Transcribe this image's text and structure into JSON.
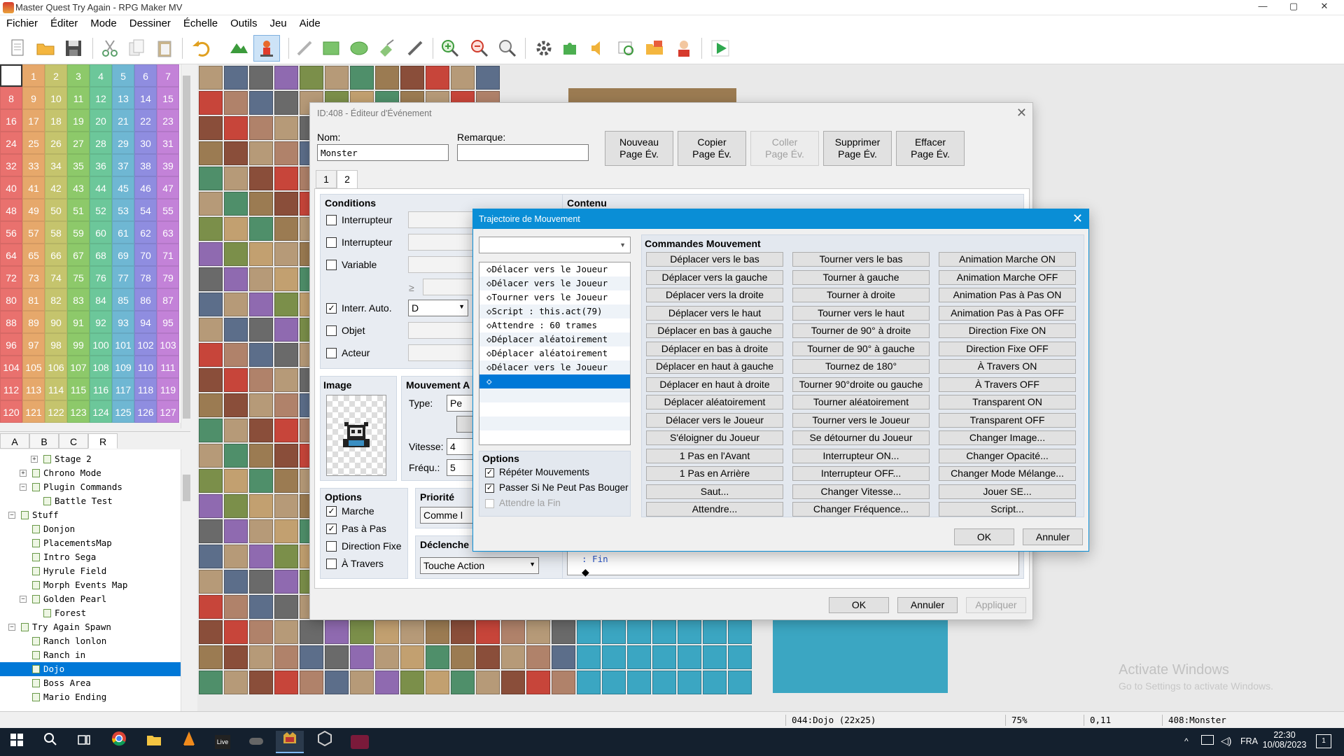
{
  "titlebar": {
    "title": "Master Quest Try Again - RPG Maker MV",
    "min": "—",
    "max": "▢",
    "close": "✕"
  },
  "menu": [
    "Fichier",
    "Éditer",
    "Mode",
    "Dessiner",
    "Échelle",
    "Outils",
    "Jeu",
    "Aide"
  ],
  "numgrid": {
    "cells": [
      "",
      "1",
      "2",
      "3",
      "4",
      "5",
      "6",
      "7",
      "8",
      "9",
      "10",
      "11",
      "12",
      "13",
      "14",
      "15",
      "16",
      "17",
      "18",
      "19",
      "20",
      "21",
      "22",
      "23",
      "24",
      "25",
      "26",
      "27",
      "28",
      "29",
      "30",
      "31",
      "32",
      "33",
      "34",
      "35",
      "36",
      "37",
      "38",
      "39",
      "40",
      "41",
      "42",
      "43",
      "44",
      "45",
      "46",
      "47",
      "48",
      "49",
      "50",
      "51",
      "52",
      "53",
      "54",
      "55",
      "56",
      "57",
      "58",
      "59",
      "60",
      "61",
      "62",
      "63",
      "64",
      "65",
      "66",
      "67",
      "68",
      "69",
      "70",
      "71",
      "72",
      "73",
      "74",
      "75",
      "76",
      "77",
      "78",
      "79",
      "80",
      "81",
      "82",
      "83",
      "84",
      "85",
      "86",
      "87",
      "88",
      "89",
      "90",
      "91",
      "92",
      "93",
      "94",
      "95",
      "96",
      "97",
      "98",
      "99",
      "100",
      "101",
      "102",
      "103",
      "104",
      "105",
      "106",
      "107",
      "108",
      "109",
      "110",
      "111",
      "112",
      "113",
      "114",
      "115",
      "116",
      "117",
      "118",
      "119",
      "120",
      "121",
      "122",
      "123",
      "124",
      "125",
      "126",
      "127"
    ],
    "colors": [
      "#e9716e",
      "#e6a86b",
      "#c5c46d",
      "#8dc96a",
      "#6cc79a",
      "#6fb7d3",
      "#8f8de0",
      "#c382d8"
    ]
  },
  "layer_tabs": [
    "A",
    "B",
    "C",
    "R"
  ],
  "tree": [
    {
      "label": "Stage 2",
      "depth": 2,
      "exp": "+"
    },
    {
      "label": "Chrono Mode",
      "depth": 1,
      "exp": "+"
    },
    {
      "label": "Plugin Commands",
      "depth": 1,
      "exp": "−"
    },
    {
      "label": "Battle Test",
      "depth": 2,
      "exp": ""
    },
    {
      "label": "Stuff",
      "depth": 0,
      "exp": "−"
    },
    {
      "label": "Donjon",
      "depth": 1,
      "exp": ""
    },
    {
      "label": "PlacementsMap",
      "depth": 1,
      "exp": ""
    },
    {
      "label": "Intro Sega",
      "depth": 1,
      "exp": ""
    },
    {
      "label": "Hyrule Field",
      "depth": 1,
      "exp": ""
    },
    {
      "label": "Morph Events Map",
      "depth": 1,
      "exp": ""
    },
    {
      "label": "Golden Pearl",
      "depth": 1,
      "exp": "−"
    },
    {
      "label": "Forest",
      "depth": 2,
      "exp": ""
    },
    {
      "label": "Try Again Spawn",
      "depth": 0,
      "exp": "−"
    },
    {
      "label": "Ranch lonlon",
      "depth": 1,
      "exp": ""
    },
    {
      "label": "Ranch in",
      "depth": 1,
      "exp": ""
    },
    {
      "label": "Dojo",
      "depth": 1,
      "exp": "",
      "selected": true
    },
    {
      "label": "Boss Area",
      "depth": 1,
      "exp": ""
    },
    {
      "label": "Mario Ending",
      "depth": 1,
      "exp": ""
    }
  ],
  "status": {
    "map": "044:Dojo (22x25)",
    "zoom": "75%",
    "coords": "0,11",
    "event": "408:Monster"
  },
  "watermark": {
    "line1": "Activate Windows",
    "line2": "Go to Settings to activate Windows."
  },
  "taskbar": {
    "lang": "FRA",
    "time": "22:30",
    "date": "10/08/2023",
    "notif": "1"
  },
  "event_editor": {
    "title": "ID:408 - Éditeur d'Événement",
    "name_label": "Nom:",
    "name_value": "Monster",
    "note_label": "Remarque:",
    "note_value": "",
    "buttons": [
      {
        "l1": "Nouveau",
        "l2": "Page Év.",
        "disabled": false
      },
      {
        "l1": "Copier",
        "l2": "Page Év.",
        "disabled": false
      },
      {
        "l1": "Coller",
        "l2": "Page Év.",
        "disabled": true
      },
      {
        "l1": "Supprimer",
        "l2": "Page Év.",
        "disabled": false
      },
      {
        "l1": "Effacer",
        "l2": "Page Év.",
        "disabled": false
      }
    ],
    "tabs": [
      "1",
      "2"
    ],
    "conditions_title": "Conditions",
    "conditions": [
      {
        "label": "Interrupteur",
        "checked": false
      },
      {
        "label": "Interrupteur",
        "checked": false
      },
      {
        "label": "Variable",
        "checked": false
      },
      {
        "label": "Interr. Auto.",
        "checked": true
      },
      {
        "label": "Objet",
        "checked": false
      },
      {
        "label": "Acteur",
        "checked": false
      }
    ],
    "ge_symbol": "≥",
    "selfswitch_value": "D",
    "contents_title": "Contenu",
    "image_title": "Image",
    "movement_title": "Mouvement A",
    "type_label": "Type:",
    "type_value": "Pe",
    "speed_label": "Vitesse:",
    "speed_value": "4",
    "freq_label": "Fréqu.:",
    "freq_value": "5",
    "options_title": "Options",
    "options": [
      {
        "label": "Marche",
        "checked": true
      },
      {
        "label": "Pas à Pas",
        "checked": true
      },
      {
        "label": "Direction Fixe",
        "checked": false
      },
      {
        "label": "À Travers",
        "checked": false
      }
    ],
    "priority_title": "Priorité",
    "priority_value": "Comme l",
    "trigger_title": "Déclenche",
    "trigger_value": "Touche Action",
    "content_fin": ": Fin",
    "content_end": "◆",
    "ok": "OK",
    "cancel": "Annuler",
    "apply": "Appliquer"
  },
  "move_route": {
    "title": "Trajectoire de Mouvement",
    "list": [
      "◇Délacer vers le Joueur",
      "◇Délacer vers le Joueur",
      "◇Tourner vers le Joueur",
      "◇Script : this.act(79)",
      "◇Attendre : 60 trames",
      "◇Déplacer aléatoirement",
      "◇Déplacer aléatoirement",
      "◇Délacer vers le Joueur",
      "◇"
    ],
    "options_title": "Options",
    "options": [
      {
        "label": "Répéter Mouvements",
        "checked": true,
        "disabled": false
      },
      {
        "label": "Passer Si Ne Peut Pas Bouger",
        "checked": true,
        "disabled": false
      },
      {
        "label": "Attendre la Fin",
        "checked": false,
        "disabled": true
      }
    ],
    "commands_title": "Commandes Mouvement",
    "col1": [
      "Déplacer vers le bas",
      "Déplacer vers la gauche",
      "Déplacer vers la droite",
      "Déplacer vers le haut",
      "Déplacer en bas à gauche",
      "Déplacer en bas à droite",
      "Déplacer en haut à gauche",
      "Déplacer en haut à droite",
      "Déplacer aléatoirement",
      "Délacer vers le Joueur",
      "S'éloigner du Joueur",
      "1 Pas en l'Avant",
      "1 Pas en Arrière",
      "Saut...",
      "Attendre..."
    ],
    "col2": [
      "Tourner vers le bas",
      "Tourner à gauche",
      "Tourner à droite",
      "Tourner vers le haut",
      "Tourner de 90° à droite",
      "Tourner de 90° à gauche",
      "Tournez de 180°",
      "Tourner 90°droite ou gauche",
      "Tourner aléatoirement",
      "Tourner vers le Joueur",
      "Se détourner du Joueur",
      "Interrupteur ON...",
      "Interrupteur OFF...",
      "Changer Vitesse...",
      "Changer Fréquence..."
    ],
    "col3": [
      "Animation Marche ON",
      "Animation Marche OFF",
      "Animation Pas à Pas ON",
      "Animation Pas à Pas OFF",
      "Direction Fixe ON",
      "Direction Fixe OFF",
      "À Travers ON",
      "À Travers OFF",
      "Transparent ON",
      "Transparent OFF",
      "Changer Image...",
      "Changer Opacité...",
      "Changer Mode Mélange...",
      "Jouer SE...",
      "Script..."
    ],
    "ok": "OK",
    "cancel": "Annuler"
  }
}
